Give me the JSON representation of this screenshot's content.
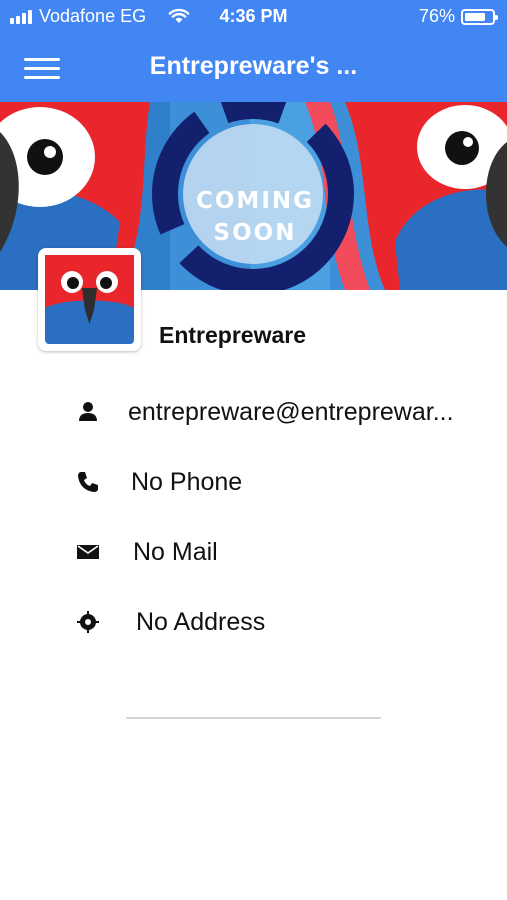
{
  "status_bar": {
    "carrier": "Vodafone EG",
    "time": "4:36 PM",
    "battery_percent": "76%",
    "battery_level": 0.76
  },
  "app_bar": {
    "title": "Entrepreware's ..."
  },
  "cover": {
    "line1": "COMING",
    "line2": "SOON"
  },
  "profile": {
    "name": "Entrepreware"
  },
  "info": {
    "email": "entrepreware@entreprewar...",
    "phone": "No Phone",
    "mail": "No Mail",
    "address": "No Address"
  },
  "colors": {
    "primary": "#4286f4",
    "parrot_red": "#e8262b",
    "parrot_blue": "#2b6fc2",
    "cover_dark_blue": "#13206d"
  },
  "icons": [
    "menu-icon",
    "user-icon",
    "phone-icon",
    "envelope-icon",
    "location-target-icon",
    "wifi-icon",
    "battery-icon",
    "signal-icon"
  ]
}
